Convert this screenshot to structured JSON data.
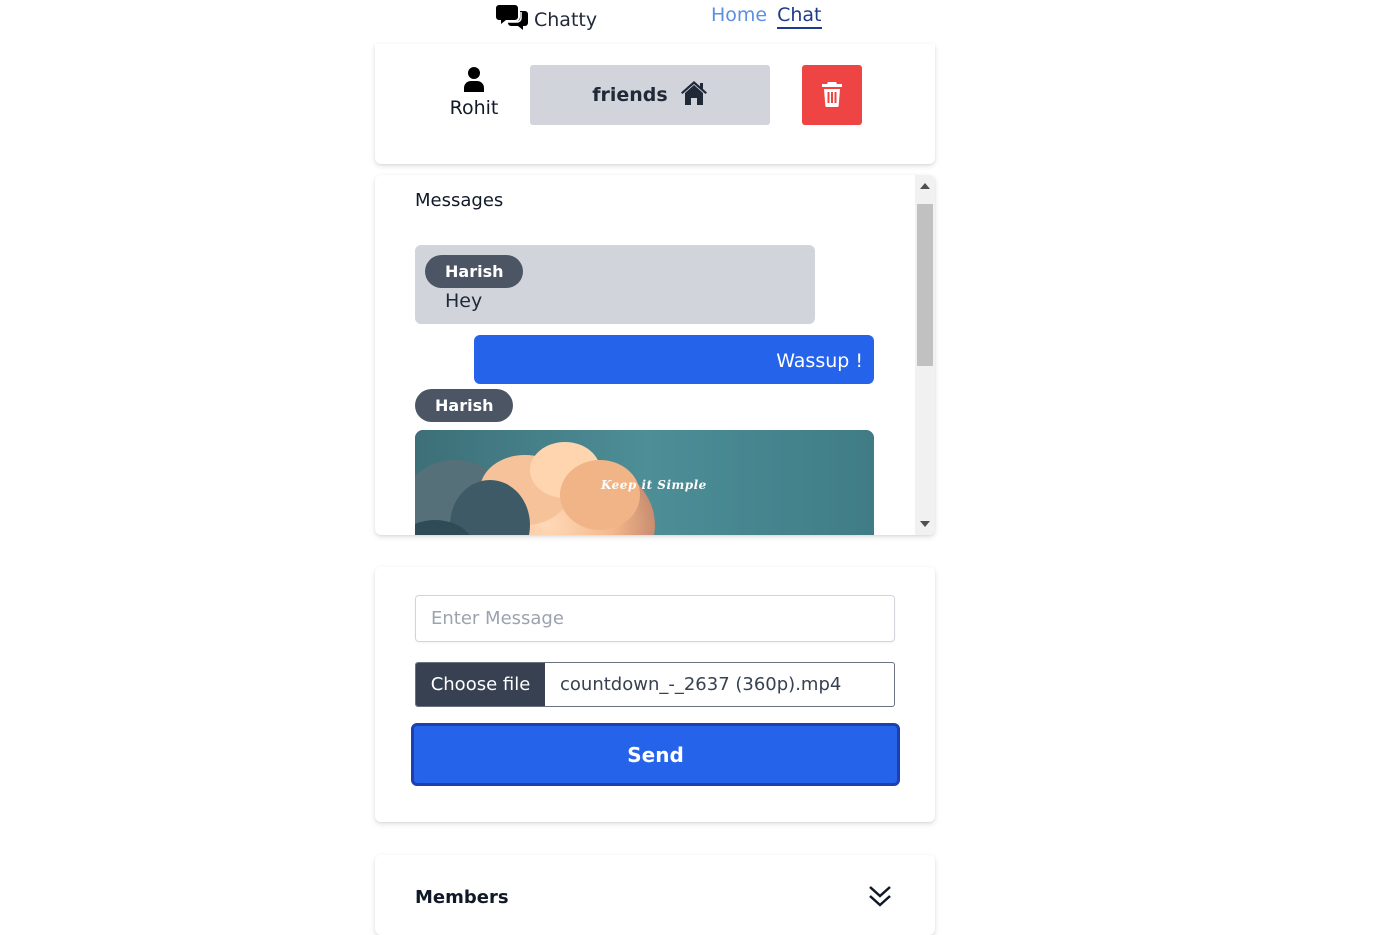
{
  "nav": {
    "brand": "Chatty",
    "brand_icon": "chat-bubbles-icon",
    "links": [
      {
        "label": "Home",
        "active": false
      },
      {
        "label": "Chat",
        "active": true
      }
    ]
  },
  "header": {
    "user_icon": "user-icon",
    "user_name": "Rohit",
    "group_name": "friends",
    "group_icon": "home-icon",
    "delete_icon": "trash-icon"
  },
  "messages": {
    "title": "Messages",
    "items": [
      {
        "sender": "Harish",
        "text": "Hey",
        "type": "received"
      },
      {
        "text": "Wassup !",
        "type": "sent"
      },
      {
        "sender": "Harish",
        "type": "media",
        "caption": "Keep it Simple"
      }
    ]
  },
  "compose": {
    "placeholder": "Enter Message",
    "file_button": "Choose file",
    "file_name": "countdown_-_2637 (360p).mp4",
    "send_label": "Send"
  },
  "members": {
    "title": "Members",
    "toggle_icon": "chevron-double-down-icon"
  },
  "colors": {
    "primary": "#2563eb",
    "danger": "#ef4444",
    "pill": "#4b5563",
    "bubble_received": "#d1d5db"
  }
}
